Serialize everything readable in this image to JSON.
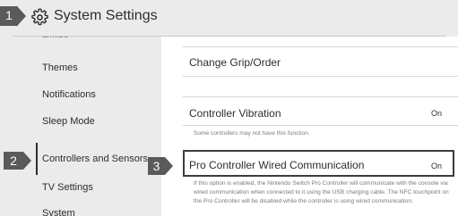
{
  "header": {
    "title": "System Settings",
    "icon": "gear-icon"
  },
  "sidebar": {
    "items": [
      {
        "label": "amiibo"
      },
      {
        "label": "Themes"
      },
      {
        "label": "Notifications"
      },
      {
        "label": "Sleep Mode"
      },
      {
        "label": "Controllers and Sensors",
        "selected": true
      },
      {
        "label": "TV Settings"
      },
      {
        "label": "System"
      }
    ]
  },
  "main": {
    "rows": [
      {
        "label": "Change Grip/Order",
        "value": ""
      },
      {
        "label": "Controller Vibration",
        "value": "On",
        "description": "Some controllers may not have this function."
      },
      {
        "label": "Pro Controller Wired Communication",
        "value": "On",
        "selected": true,
        "description": "If this option is enabled, the Nintendo Switch Pro Controller will communicate with the console via wired communication when connected to it using the USB charging cable. The NFC touchpoint on the Pro Controller will be disabled while the controller is using wired communication."
      }
    ]
  },
  "badges": [
    "1",
    "2",
    "3"
  ],
  "colors": {
    "background": "#ebebeb",
    "panel": "#ffffff",
    "badge": "#5a5a5a",
    "text": "#2d2d2d"
  }
}
